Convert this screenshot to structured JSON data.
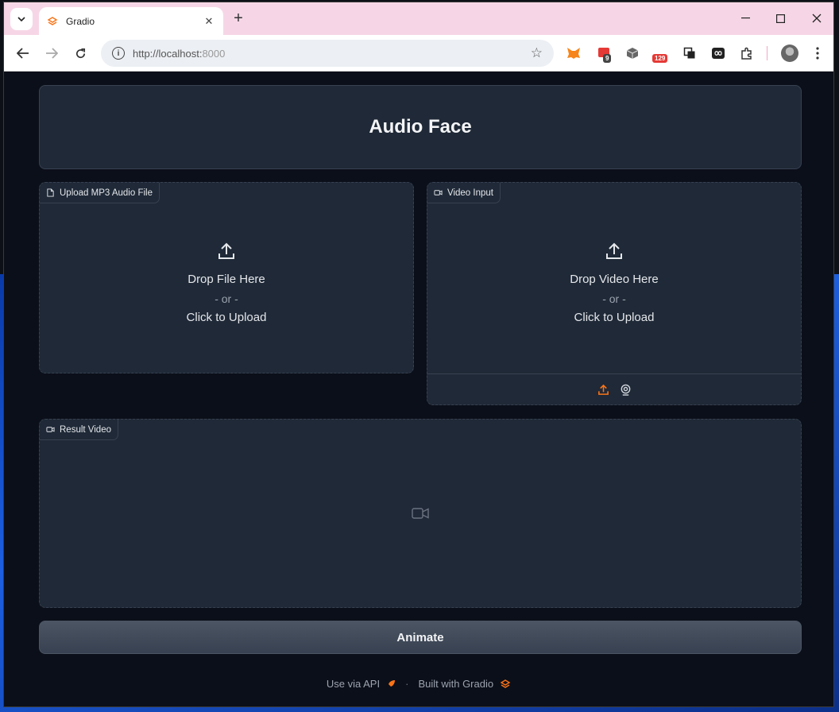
{
  "browser": {
    "tab_title": "Gradio",
    "url_host": "http://localhost:",
    "url_port": "8000",
    "extension_badges": [
      "9",
      "129"
    ],
    "accent_color": "#f97316"
  },
  "app": {
    "title": "Audio Face",
    "audio_upload": {
      "label": "Upload MP3 Audio File",
      "drop_text": "Drop File Here",
      "or_text": "- or -",
      "click_text": "Click to Upload"
    },
    "video_input": {
      "label": "Video Input",
      "drop_text": "Drop Video Here",
      "or_text": "- or -",
      "click_text": "Click to Upload"
    },
    "result_video": {
      "label": "Result Video"
    },
    "animate_button": "Animate",
    "footer": {
      "api_text": "Use via API",
      "separator": "·",
      "built_text": "Built with Gradio"
    }
  },
  "icons": [
    "file-icon",
    "video-icon",
    "upload-icon",
    "webcam-icon",
    "rocket-icon",
    "gradio-logo-icon"
  ]
}
